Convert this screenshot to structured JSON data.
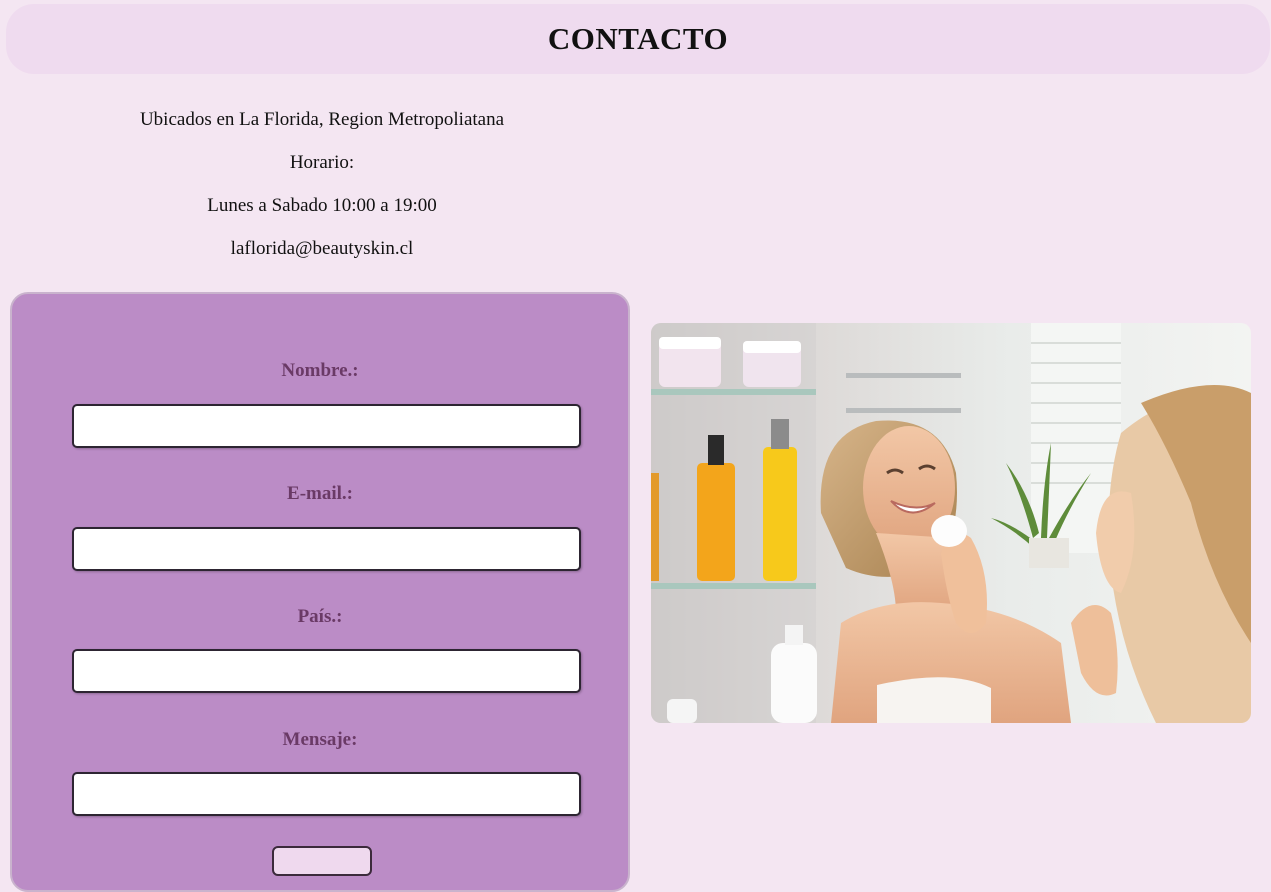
{
  "header": {
    "title": "CONTACTO"
  },
  "info": {
    "location": "Ubicados en La Florida, Region Metropoliatana",
    "hours_label": "Horario:",
    "hours": "Lunes a Sabado 10:00 a 19:00",
    "email": "laflorida@beautyskin.cl"
  },
  "form": {
    "name_label": "Nombre.:",
    "email_label": "E-mail.:",
    "country_label": "País.:",
    "message_label": "Mensaje:",
    "name_value": "",
    "email_value": "",
    "country_value": "",
    "message_value": ""
  },
  "colors": {
    "page_background": "#f4e6f2",
    "header_background": "#efdbef",
    "form_background": "#bb8cc6",
    "label_color": "#6a3a66"
  },
  "photo": {
    "subject": "woman-cleansing-face-photo"
  }
}
